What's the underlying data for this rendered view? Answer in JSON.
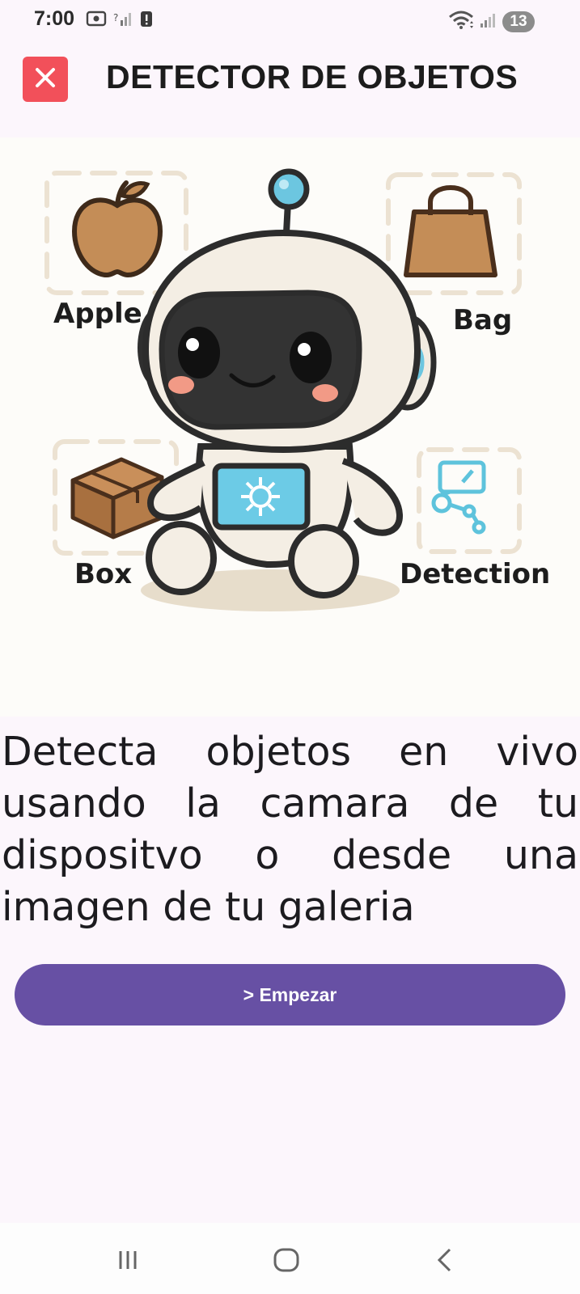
{
  "status_bar": {
    "time": "7:00",
    "notification_count": "13",
    "icons": [
      "screenshot-icon",
      "no-signal-icon",
      "alert-icon",
      "wifi-icon",
      "signal-icon"
    ]
  },
  "app_bar": {
    "title": "DETECTOR DE OBJETOS",
    "close_icon": "close-icon",
    "close_color": "#f2505a"
  },
  "hero": {
    "labels": {
      "apple": "Apple",
      "bag": "Bag",
      "box": "Box",
      "detection": "Detection"
    }
  },
  "description": "Detecta objetos en vivo usando la camara de tu dispositvo o desde una imagen de tu galeria",
  "start_button": {
    "label": "> Empezar",
    "color": "#6750a4"
  },
  "nav_bar": {
    "icons": [
      "recents-icon",
      "home-icon",
      "back-icon"
    ]
  }
}
